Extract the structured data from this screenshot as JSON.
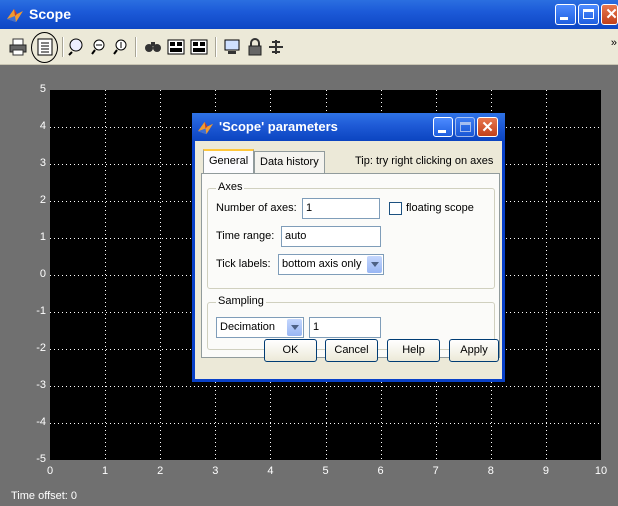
{
  "window": {
    "title": "Scope"
  },
  "toolbar": {
    "icons": [
      "printer-icon",
      "parameters-icon",
      "zoom-icon",
      "zoom-x-icon",
      "zoom-y-icon",
      "autoscale-icon",
      "save-axes-icon",
      "restore-axes-icon",
      "float-icon",
      "lock-icon",
      "signal-selection-icon"
    ]
  },
  "plot": {
    "y_ticks": [
      "5",
      "4",
      "3",
      "2",
      "1",
      "0",
      "-1",
      "-2",
      "-3",
      "-4",
      "-5"
    ],
    "x_ticks": [
      "0",
      "1",
      "2",
      "3",
      "4",
      "5",
      "6",
      "7",
      "8",
      "9",
      "10"
    ],
    "time_offset_label": "Time offset:",
    "time_offset_value": "0",
    "background": "#000000",
    "grid_color": "#ffffff"
  },
  "dialog": {
    "title": "'Scope' parameters",
    "tabs": [
      {
        "label": "General"
      },
      {
        "label": "Data history"
      }
    ],
    "tip": "Tip: try right clicking on axes",
    "axes": {
      "group_label": "Axes",
      "num_axes_label": "Number of axes:",
      "num_axes_value": "1",
      "floating_label": "floating scope",
      "time_range_label": "Time range:",
      "time_range_value": "auto",
      "tick_labels_label": "Tick labels:",
      "tick_labels_value": "bottom axis only"
    },
    "sampling": {
      "group_label": "Sampling",
      "mode_value": "Decimation",
      "factor_value": "1"
    },
    "buttons": {
      "ok": "OK",
      "cancel": "Cancel",
      "help": "Help",
      "apply": "Apply"
    }
  }
}
